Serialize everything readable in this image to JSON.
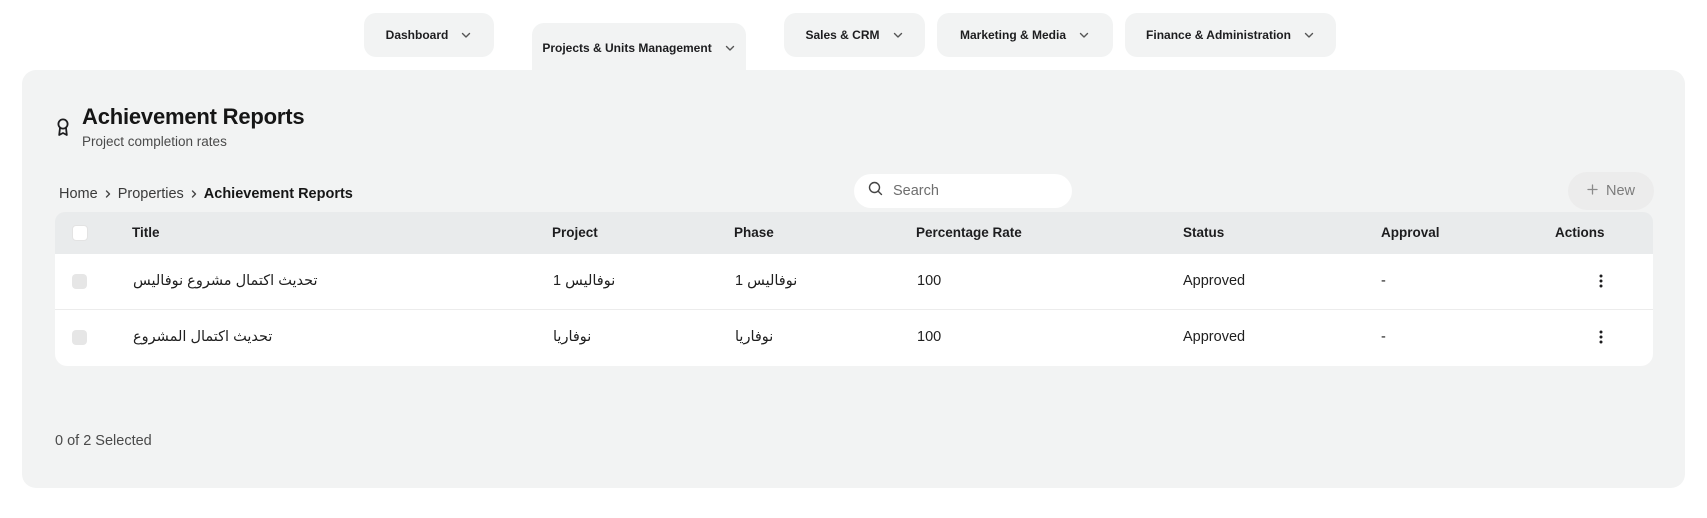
{
  "nav": {
    "tabs": [
      {
        "label": "Dashboard"
      },
      {
        "label": "Projects & Units Management"
      },
      {
        "label": "Sales & CRM"
      },
      {
        "label": "Marketing & Media"
      },
      {
        "label": "Finance & Administration"
      }
    ],
    "active_tab": "Projects & Units Management"
  },
  "header": {
    "icon": "award-ribbon-icon",
    "title": "Achievement Reports",
    "subtitle": "Project completion rates"
  },
  "breadcrumb": {
    "items": [
      {
        "label": "Home"
      },
      {
        "label": "Properties"
      },
      {
        "label": "Achievement Reports"
      }
    ]
  },
  "search": {
    "placeholder": "Search",
    "value": ""
  },
  "toolbar": {
    "new_label": "New"
  },
  "table": {
    "columns": [
      "Title",
      "Project",
      "Phase",
      "Percentage Rate",
      "Status",
      "Approval",
      "Actions"
    ],
    "rows": [
      {
        "title": "تحديث اكتمال مشروع نوفاليس",
        "project": "نوفاليس 1",
        "phase": "نوفاليس 1",
        "rate": "100",
        "status": "Approved",
        "approval": "-"
      },
      {
        "title": "تحديث اكتمال المشروع",
        "project": "نوفاريا",
        "phase": "نوفاريا",
        "rate": "100",
        "status": "Approved",
        "approval": "-"
      }
    ]
  },
  "footer": {
    "selection_text": "0 of 2 Selected"
  },
  "colors": {
    "panel_bg": "#f2f3f3",
    "header_row_bg": "#e9ebec",
    "text_primary": "#161616"
  }
}
